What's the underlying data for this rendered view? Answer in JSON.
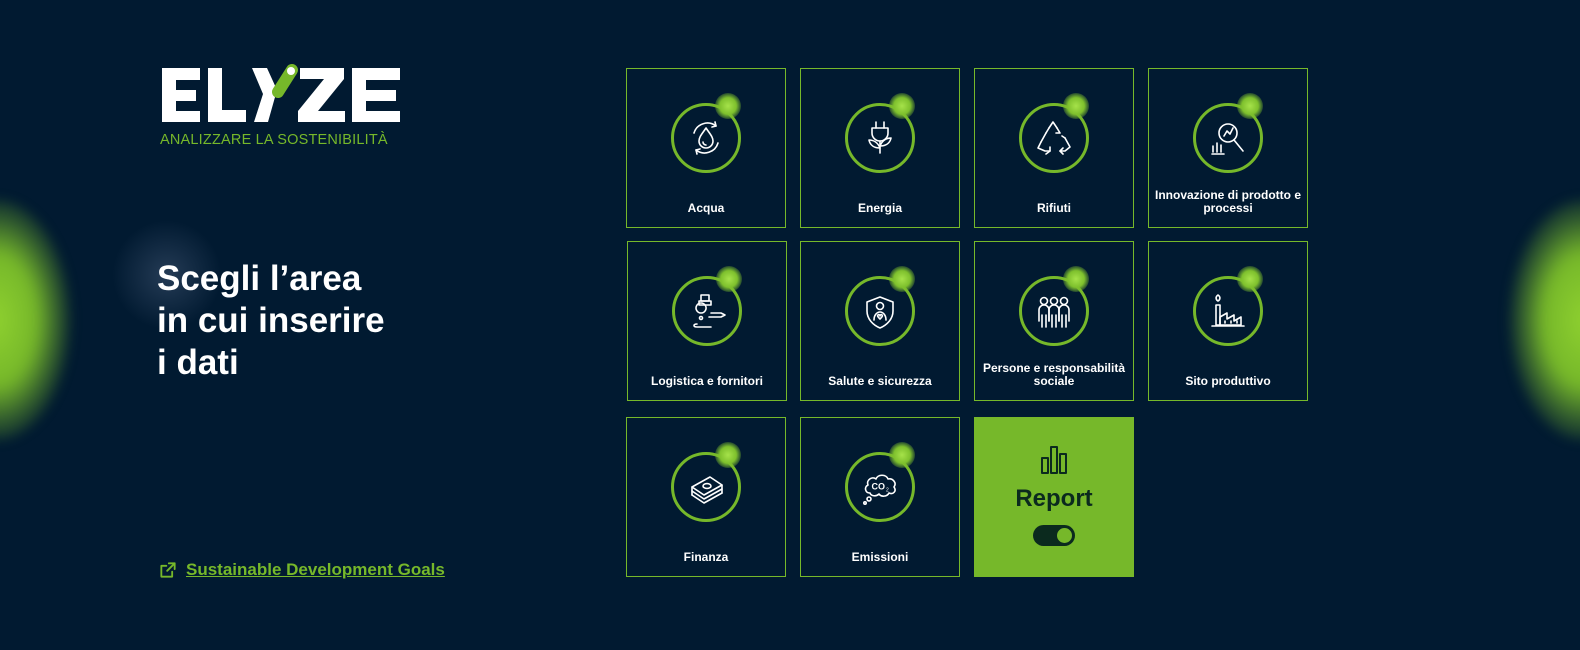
{
  "brand": {
    "name": "ELYZE",
    "tagline": "ANALIZZARE LA SOSTENIBILITÀ",
    "accent_color": "#76b82a",
    "background_color": "#011a31"
  },
  "headline": {
    "line1": "Scegli l’area",
    "line2": "in cui inserire",
    "line3": "i dati"
  },
  "sdg_link": {
    "label": "Sustainable Development Goals",
    "icon": "external-link-icon"
  },
  "areas": [
    {
      "label": "Acqua",
      "icon": "water-drop-cycle-icon"
    },
    {
      "label": "Energia",
      "icon": "plug-leaf-icon"
    },
    {
      "label": "Rifiuti",
      "icon": "recycle-icon"
    },
    {
      "label": "Innovazione di prodotto e processi",
      "icon": "innovation-magnifier-icon"
    },
    {
      "label": "Logistica e fornitori",
      "icon": "logistics-route-icon"
    },
    {
      "label": "Salute e sicurezza",
      "icon": "health-shield-icon"
    },
    {
      "label": "Persone e responsabilità sociale",
      "icon": "people-group-icon"
    },
    {
      "label": "Sito produttivo",
      "icon": "factory-icon"
    },
    {
      "label": "Finanza",
      "icon": "money-stack-icon"
    },
    {
      "label": "Emissioni",
      "icon": "co2-cloud-icon"
    }
  ],
  "report": {
    "label": "Report",
    "icon": "bar-chart-icon",
    "toggle_on": true
  }
}
